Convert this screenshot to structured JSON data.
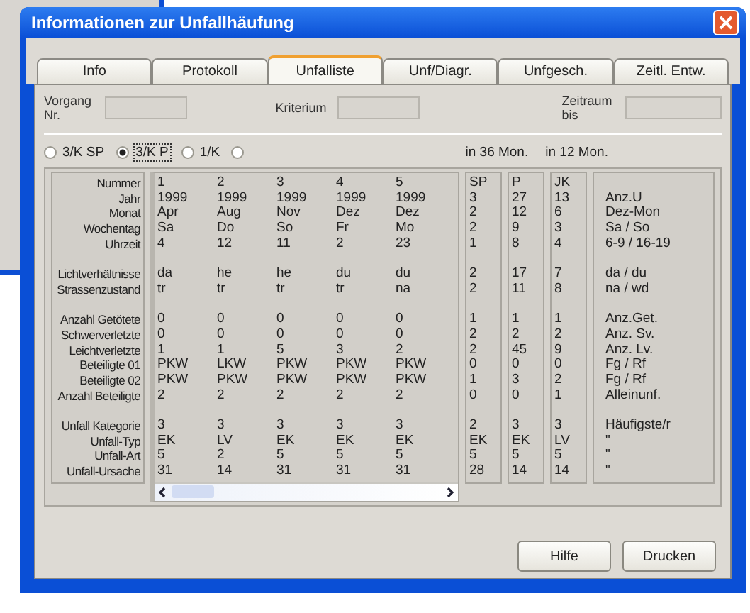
{
  "window": {
    "title": "Informationen zur Unfallhäufung"
  },
  "tabs": [
    {
      "label": "Info",
      "selected": false
    },
    {
      "label": "Protokoll",
      "selected": false
    },
    {
      "label": "Unfalliste",
      "selected": true
    },
    {
      "label": "Unf/Diagr.",
      "selected": false
    },
    {
      "label": "Unfgesch.",
      "selected": false
    },
    {
      "label": "Zeitl. Entw.",
      "selected": false
    }
  ],
  "fields": [
    {
      "label": "Vorgang Nr."
    },
    {
      "label": "Kriterium"
    },
    {
      "label": "Zeitraum bis"
    }
  ],
  "radios": [
    {
      "label": "3/K SP",
      "selected": false
    },
    {
      "label": "3/K P",
      "selected": true
    },
    {
      "label": "1/K",
      "selected": false
    },
    {
      "selected": false
    }
  ],
  "period_labels": [
    "in 36 Mon.",
    "in 12 Mon."
  ],
  "row_groups": [
    {
      "rows": [
        {
          "label": "Nummer",
          "accidents": [
            "1",
            "2",
            "3",
            "4",
            "5"
          ],
          "sp": "SP",
          "p": "P",
          "jk": "JK"
        },
        {
          "label": "Jahr",
          "accidents": [
            "1999",
            "1999",
            "1999",
            "1999",
            "1999"
          ],
          "sp": "3",
          "p": "27",
          "jk": "13",
          "note": "Anz.U"
        },
        {
          "label": "Monat",
          "accidents": [
            "Apr",
            "Aug",
            "Nov",
            "Dez",
            "Dez"
          ],
          "sp": "2",
          "p": "12",
          "jk": "6",
          "note": "Dez-Mon"
        },
        {
          "label": "Wochentag",
          "accidents": [
            "Sa",
            "Do",
            "So",
            "Fr",
            "Mo"
          ],
          "sp": "2",
          "p": "9",
          "jk": "3",
          "note": "Sa / So"
        },
        {
          "label": "Uhrzeit",
          "accidents": [
            "4",
            "12",
            "11",
            "2",
            "23"
          ],
          "sp": "1",
          "p": "8",
          "jk": "4",
          "note": "6-9 / 16-19"
        }
      ]
    },
    {
      "rows": [
        {
          "label": "Lichtverhältnisse",
          "accidents": [
            "da",
            "he",
            "he",
            "du",
            "du"
          ],
          "sp": "2",
          "p": "17",
          "jk": "7",
          "note": "da / du"
        },
        {
          "label": "Strassenzustand",
          "accidents": [
            "tr",
            "tr",
            "tr",
            "tr",
            "na"
          ],
          "sp": "2",
          "p": "11",
          "jk": "8",
          "note": "na / wd"
        }
      ]
    },
    {
      "rows": [
        {
          "label": "Anzahl Getötete",
          "accidents": [
            "0",
            "0",
            "0",
            "0",
            "0"
          ],
          "sp": "1",
          "p": "1",
          "jk": "1",
          "note": "Anz.Get."
        },
        {
          "label": "Schwerverletzte",
          "accidents": [
            "0",
            "0",
            "0",
            "0",
            "0"
          ],
          "sp": "2",
          "p": "2",
          "jk": "2",
          "note": "Anz. Sv."
        },
        {
          "label": "Leichtverletzte",
          "accidents": [
            "1",
            "1",
            "5",
            "3",
            "2"
          ],
          "sp": "2",
          "p": "45",
          "jk": "9",
          "note": "Anz. Lv."
        },
        {
          "label": "Beteiligte 01",
          "accidents": [
            "PKW",
            "LKW",
            "PKW",
            "PKW",
            "PKW"
          ],
          "sp": "0",
          "p": "0",
          "jk": "0",
          "note": "Fg / Rf"
        },
        {
          "label": "Beteiligte 02",
          "accidents": [
            "PKW",
            "PKW",
            "PKW",
            "PKW",
            "PKW"
          ],
          "sp": "1",
          "p": "3",
          "jk": "2",
          "note": "Fg / Rf"
        },
        {
          "label": "Anzahl Beteiligte",
          "accidents": [
            "2",
            "2",
            "2",
            "2",
            "2"
          ],
          "sp": "0",
          "p": "0",
          "jk": "1",
          "note": "Alleinunf."
        }
      ]
    },
    {
      "rows": [
        {
          "label": "Unfall Kategorie",
          "accidents": [
            "3",
            "3",
            "3",
            "3",
            "3"
          ],
          "sp": "2",
          "p": "3",
          "jk": "3",
          "note": "Häufigste/r"
        },
        {
          "label": "Unfall-Typ",
          "accidents": [
            "EK",
            "LV",
            "EK",
            "EK",
            "EK"
          ],
          "sp": "EK",
          "p": "EK",
          "jk": "LV",
          "note": "\""
        },
        {
          "label": "Unfall-Art",
          "accidents": [
            "5",
            "2",
            "5",
            "5",
            "5"
          ],
          "sp": "5",
          "p": "5",
          "jk": "5",
          "note": "\""
        },
        {
          "label": "Unfall-Ursache",
          "accidents": [
            "31",
            "14",
            "31",
            "31",
            "31"
          ],
          "sp": "28",
          "p": "14",
          "jk": "14",
          "note": "\""
        }
      ]
    }
  ],
  "buttons": [
    "Hilfe",
    "Drucken"
  ]
}
